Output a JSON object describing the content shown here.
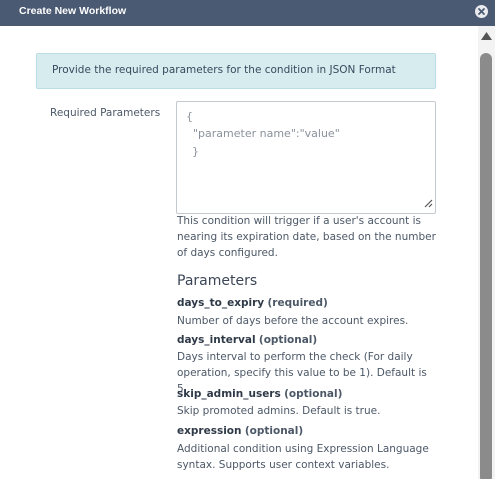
{
  "dialog": {
    "title": "Create New Workflow",
    "info_text": "Provide the required parameters for the condition in JSON Format",
    "required_label": "Required Parameters",
    "textarea_lines": [
      "{",
      "\"parameter name\":\"value\"",
      "}"
    ],
    "condition_description": "This condition will trigger if a user's account is nearing its expiration date, based on the number of days configured.",
    "parameters_heading": "Parameters",
    "parameters": [
      {
        "name": "days_to_expiry",
        "tag": "(required)",
        "description": "Number of days before the account expires."
      },
      {
        "name": "days_interval",
        "tag": "(optional)",
        "description": "Days interval to perform the check (For daily operation, specify this value to be 1). Default is 5."
      },
      {
        "name": "skip_admin_users",
        "tag": "(optional)",
        "description": "Skip promoted admins. Default is true."
      },
      {
        "name": "expression",
        "tag": "(optional)",
        "description": "Additional condition using Expression Language syntax. Supports user context variables."
      }
    ]
  },
  "icons": {
    "close": "close-circle-icon",
    "scroll_up": "scroll-up-arrow-icon",
    "resize": "resize-grip-icon"
  },
  "colors": {
    "titlebar": "#4b5a73",
    "info_bg": "#d7ecef",
    "text": "#4c5867"
  }
}
